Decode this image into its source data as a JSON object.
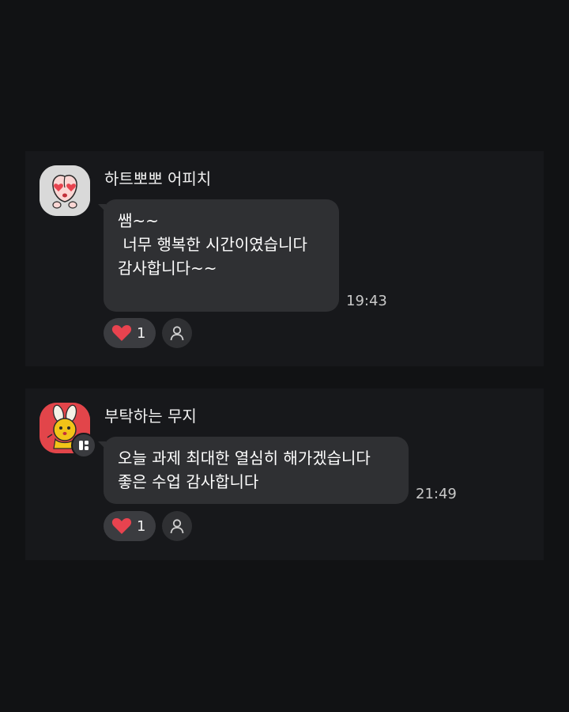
{
  "messages": [
    {
      "sender": "하트뽀뽀 어피치",
      "lines": [
        "쌤~~",
        " 너무 행복한 시간이였습니다",
        "감사합니다~~"
      ],
      "time": "19:43",
      "reaction": {
        "icon": "heart-icon",
        "count": "1"
      },
      "avatar_icon": "peach-heart-eyes-avatar"
    },
    {
      "sender": "부탁하는 무지",
      "lines": [
        "오늘 과제 최대한 열심히 해가겠습니다",
        "좋은 수업 감사합니다"
      ],
      "time": "21:49",
      "reaction": {
        "icon": "heart-icon",
        "count": "1"
      },
      "avatar_icon": "muzi-bowing-avatar",
      "badge_icon": "board-icon"
    }
  ],
  "colors": {
    "background": "#111214",
    "card": "#17181b",
    "bubble": "#2f3033",
    "heart": "#e8434f"
  }
}
